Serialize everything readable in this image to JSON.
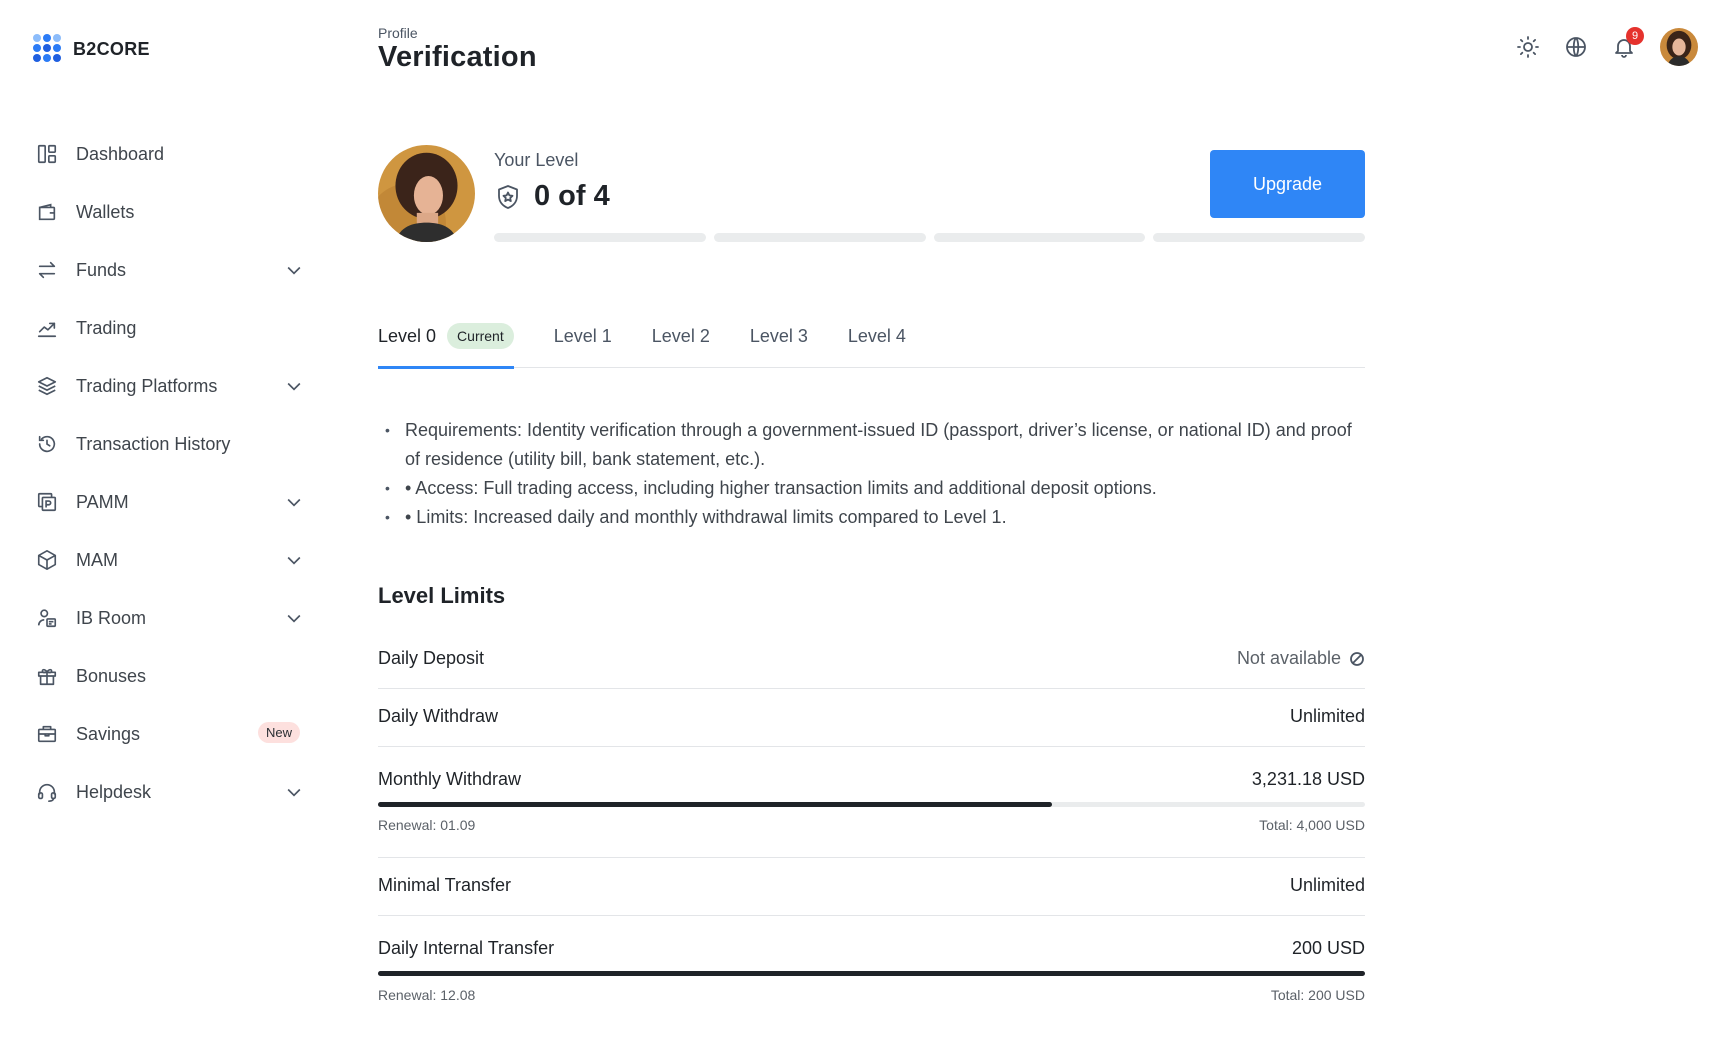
{
  "brand": {
    "name": "B2CORE"
  },
  "sidebar": {
    "items": [
      {
        "label": "Dashboard",
        "icon": "dashboard-icon",
        "has_submenu": false
      },
      {
        "label": "Wallets",
        "icon": "wallet-icon",
        "has_submenu": false
      },
      {
        "label": "Funds",
        "icon": "transfer-arrows-icon",
        "has_submenu": true
      },
      {
        "label": "Trading",
        "icon": "trending-up-icon",
        "has_submenu": false
      },
      {
        "label": "Trading Platforms",
        "icon": "layers-icon",
        "has_submenu": true
      },
      {
        "label": "Transaction History",
        "icon": "history-icon",
        "has_submenu": false
      },
      {
        "label": "PAMM",
        "icon": "pamm-icon",
        "has_submenu": true
      },
      {
        "label": "MAM",
        "icon": "cube-icon",
        "has_submenu": true
      },
      {
        "label": "IB Room",
        "icon": "user-group-icon",
        "has_submenu": true
      },
      {
        "label": "Bonuses",
        "icon": "gift-icon",
        "has_submenu": false
      },
      {
        "label": "Savings",
        "icon": "briefcase-icon",
        "has_submenu": false,
        "badge": "New"
      },
      {
        "label": "Helpdesk",
        "icon": "headset-icon",
        "has_submenu": true
      }
    ]
  },
  "header": {
    "breadcrumb": "Profile",
    "title": "Verification",
    "notifications_count": "9",
    "icons": [
      "sun-icon",
      "globe-icon",
      "bell-icon"
    ]
  },
  "level_card": {
    "label": "Your Level",
    "value": "0 of 4",
    "upgrade_label": "Upgrade",
    "progress": {
      "completed": 0,
      "total": 4
    }
  },
  "tabs": [
    {
      "label": "Level 0",
      "badge": "Current",
      "active": true
    },
    {
      "label": "Level 1",
      "active": false
    },
    {
      "label": "Level 2",
      "active": false
    },
    {
      "label": "Level 3",
      "active": false
    },
    {
      "label": "Level 4",
      "active": false
    }
  ],
  "requirements": [
    "Requirements: Identity verification through a government-issued ID (passport, driver’s license, or national ID) and proof of residence (utility bill, bank statement, etc.).",
    "• Access: Full trading access, including higher transaction limits and additional deposit options.",
    "• Limits: Increased daily and monthly withdrawal limits compared to Level 1."
  ],
  "limits": {
    "title": "Level Limits",
    "rows": [
      {
        "label": "Daily Deposit",
        "value": "Not available"
      },
      {
        "label": "Daily Withdraw",
        "value": "Unlimited"
      },
      {
        "label": "Monthly Withdraw",
        "value": "3,231.18 USD",
        "progress": 0.6825,
        "renewal": "Renewal: 01.09",
        "total": "Total: 4,000 USD"
      },
      {
        "label": "Minimal Transfer",
        "value": "Unlimited"
      },
      {
        "label": "Daily Internal Transfer",
        "value": "200 USD",
        "progress": 1.0,
        "renewal": "Renewal: 12.08",
        "total": "Total: 200 USD"
      }
    ]
  },
  "colors": {
    "accent": "#2f86f6",
    "danger": "#e5322d",
    "current_badge": "#dbeedd",
    "new_badge": "#fde0de"
  }
}
